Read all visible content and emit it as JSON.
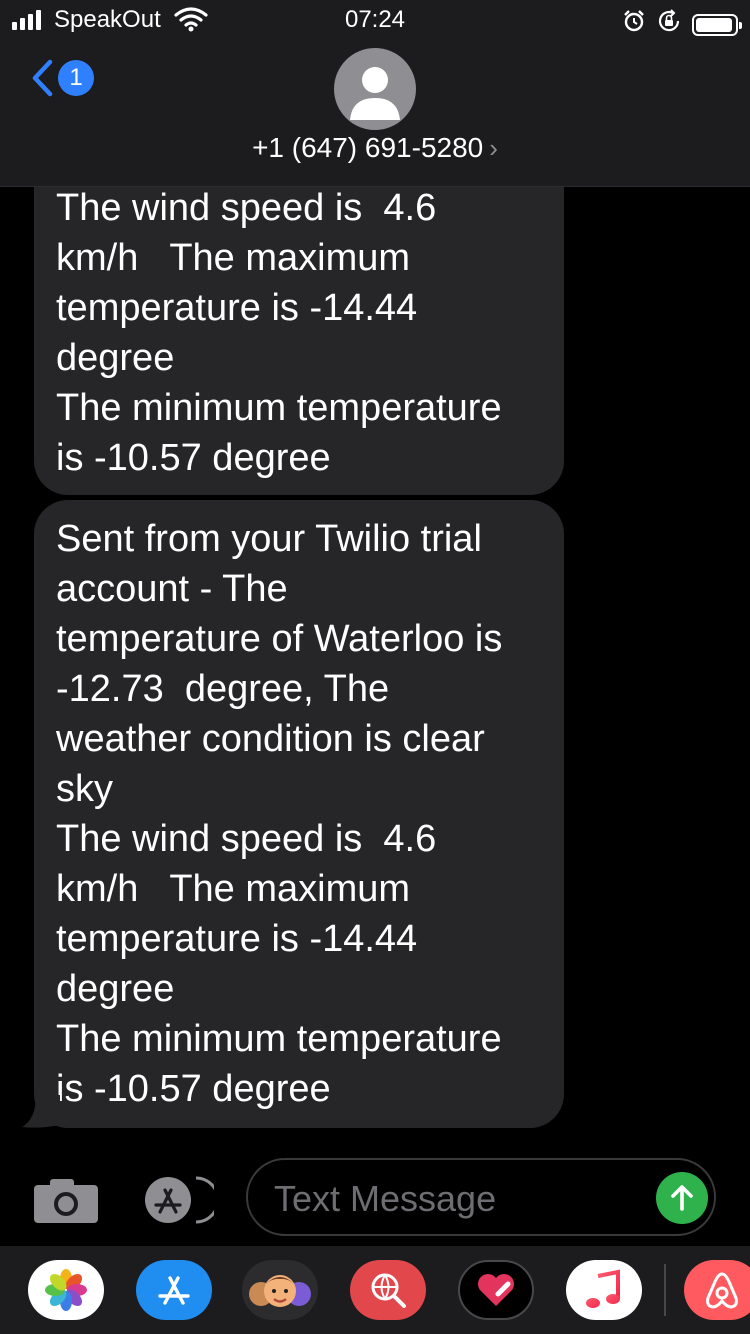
{
  "status_bar": {
    "carrier": "SpeakOut",
    "time": "07:24",
    "signal_bars": 4,
    "battery_level": 0.95
  },
  "header": {
    "back_badge": "1",
    "contact": "+1 (647) 691-5280",
    "chevron": "›"
  },
  "messages": [
    {
      "text": "The wind speed is  4.6\nkm/h   The maximum\ntemperature is -14.44\ndegree\nThe minimum temperature\nis -10.57 degree"
    },
    {
      "text": "Sent from your Twilio trial\naccount - The\ntemperature of Waterloo is\n-12.73  degree, The\nweather condition is clear\nsky\nThe wind speed is  4.6\nkm/h   The maximum\ntemperature is -14.44\ndegree\nThe minimum temperature\nis -10.57 degree"
    }
  ],
  "input": {
    "placeholder": "Text Message",
    "value": ""
  },
  "colors": {
    "accent": "#2f80ff",
    "send": "#2fb24c",
    "bubble": "#262628"
  },
  "drawer_apps": [
    {
      "name": "photos-icon"
    },
    {
      "name": "app-store-icon"
    },
    {
      "name": "memoji-icon"
    },
    {
      "name": "web-search-icon"
    },
    {
      "name": "digital-touch-icon"
    },
    {
      "name": "music-icon"
    },
    {
      "name": "airbnb-icon"
    }
  ]
}
